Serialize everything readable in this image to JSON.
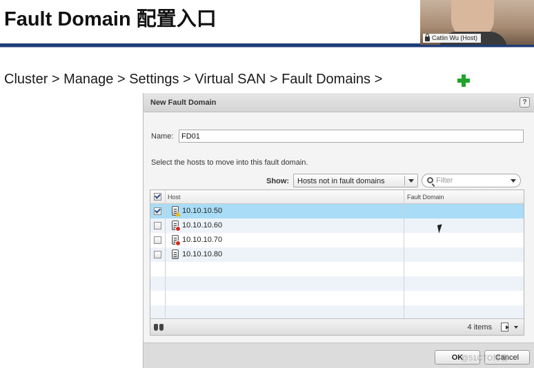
{
  "slide": {
    "title": "Fault Domain 配置入口",
    "breadcrumb": "Cluster > Manage > Settings > Virtual SAN > Fault Domains >"
  },
  "webcam": {
    "participant": "Catlin Wu (Host)"
  },
  "dialog": {
    "title": "New Fault Domain",
    "help": "?",
    "name_label": "Name:",
    "name_value": "FD01",
    "instruction": "Select the hosts to move into this fault domain.",
    "show_label": "Show:",
    "show_value": "Hosts not in fault domains",
    "filter_placeholder": "Filter",
    "columns": {
      "host": "Host",
      "fault_domain": "Fault Domain"
    },
    "rows": [
      {
        "host": "10.10.10.50",
        "fault_domain": "",
        "checked": true,
        "status": "warning"
      },
      {
        "host": "10.10.10.60",
        "fault_domain": "",
        "checked": false,
        "status": "error"
      },
      {
        "host": "10.10.10.70",
        "fault_domain": "",
        "checked": false,
        "status": "error"
      },
      {
        "host": "10.10.10.80",
        "fault_domain": "",
        "checked": false,
        "status": "normal"
      }
    ],
    "items_count": "4 items",
    "ok_label": "OK",
    "cancel_label": "Cancel"
  },
  "watermark": "@51CTO博客",
  "colors": {
    "title_rule": "#1f3c78",
    "add_icon": "#21a32b",
    "selected_row": "#a9dcf6",
    "warning": "#e8b923",
    "error": "#d42b1f"
  }
}
